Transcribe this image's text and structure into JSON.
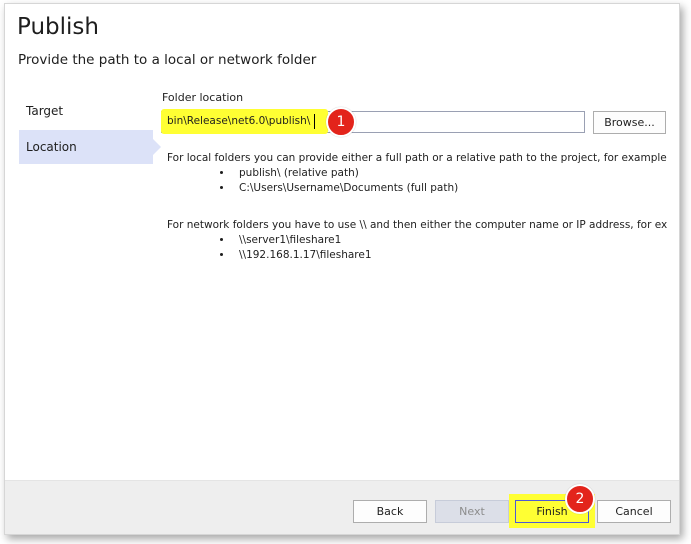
{
  "dialog": {
    "title": "Publish",
    "subtitle": "Provide the path to a local or network folder"
  },
  "nav": {
    "items": [
      {
        "label": "Target",
        "active": false
      },
      {
        "label": "Location",
        "active": true
      }
    ]
  },
  "location": {
    "field_label": "Folder location",
    "path_value": "bin\\Release\\net6.0\\publish\\",
    "browse_label": "Browse..."
  },
  "help": {
    "local_intro": "For local folders you can provide either a full path or a relative path to the project, for example:",
    "local_examples": [
      "publish\\ (relative path)",
      "C:\\Users\\Username\\Documents (full path)"
    ],
    "network_intro": "For network folders you have to use \\\\ and then either the computer name or IP address, for example:",
    "network_examples": [
      "\\\\server1\\fileshare1",
      "\\\\192.168.1.17\\fileshare1"
    ]
  },
  "annotations": {
    "step1": "1",
    "step2": "2"
  },
  "footer": {
    "back_label": "Back",
    "next_label": "Next",
    "finish_label": "Finish",
    "cancel_label": "Cancel"
  },
  "colors": {
    "highlight": "#ffff33",
    "badge": "#e3241b",
    "nav_active": "#dce2f8"
  }
}
